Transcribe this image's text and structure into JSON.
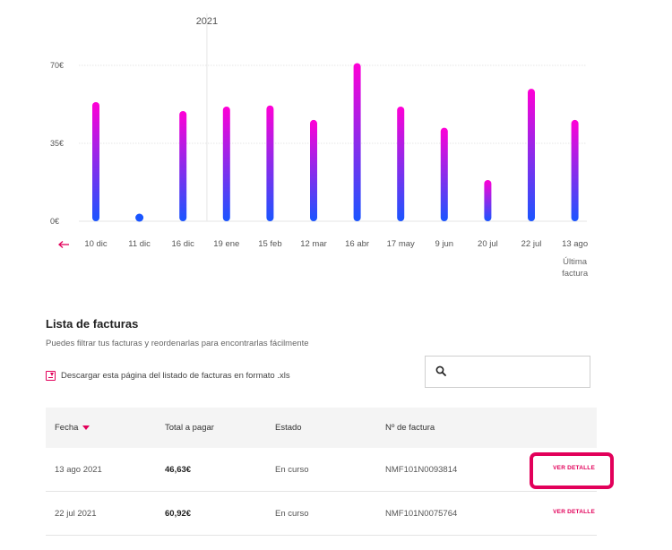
{
  "chart_data": {
    "type": "bar",
    "year_label": "2021",
    "categories": [
      "10 dic",
      "11 dic",
      "16 dic",
      "19 ene",
      "15 feb",
      "12 mar",
      "16 abr",
      "17 may",
      "9 jun",
      "20 jul",
      "22 jul",
      "13 ago"
    ],
    "values": [
      53.5,
      1.5,
      49.5,
      51.5,
      52,
      45.5,
      71,
      51.5,
      42,
      18.5,
      59.5,
      45.5
    ],
    "ylim": [
      0,
      70
    ],
    "yticks": [
      0,
      35,
      70
    ],
    "ytick_labels": [
      "0€",
      "35€",
      "70€"
    ],
    "grid": true,
    "last_note": [
      "Última",
      "factura"
    ],
    "colors": {
      "bar_top": "#ff00d6",
      "bar_bottom": "#1a55ff",
      "accent": "#e2005a"
    }
  },
  "list": {
    "title": "Lista de facturas",
    "subtitle": "Puedes filtrar tus facturas y reordenarlas para encontrarlas fácilmente",
    "download_label": "Descargar esta página del listado de facturas en formato .xls",
    "search_placeholder": ""
  },
  "table": {
    "headers": {
      "date": "Fecha",
      "total": "Total a pagar",
      "status": "Estado",
      "invoice": "Nº de factura"
    },
    "rows": [
      {
        "date": "13 ago 2021",
        "total": "46,63€",
        "status": "En curso",
        "invoice": "NMF101N0093814",
        "action": "VER DETALLE"
      },
      {
        "date": "22 jul 2021",
        "total": "60,92€",
        "status": "En curso",
        "invoice": "NMF101N0075764",
        "action": "VER DETALLE"
      }
    ]
  }
}
